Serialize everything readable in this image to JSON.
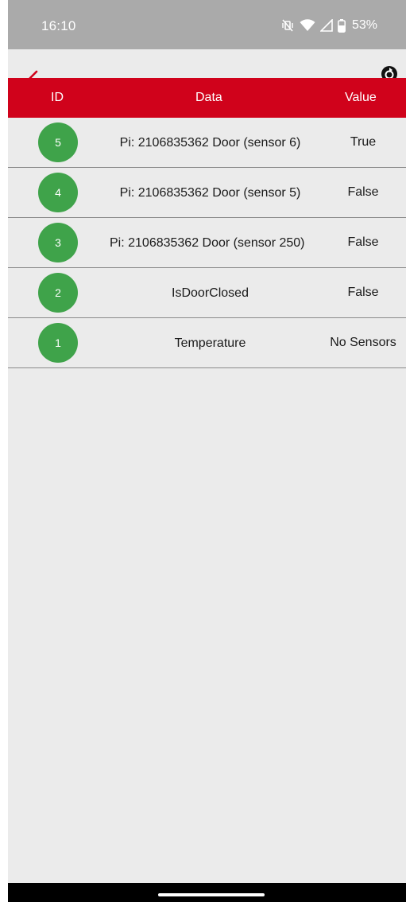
{
  "status_bar": {
    "time": "16:10",
    "battery": "53%",
    "icons": [
      "vibrate-off-icon",
      "wifi-icon",
      "signal-icon",
      "battery-icon"
    ]
  },
  "app_bar": {
    "icons": [
      "back-arrow-icon",
      "refresh-icon"
    ],
    "accent_color": "#d0021b"
  },
  "table": {
    "headers": {
      "id": "ID",
      "data": "Data",
      "value": "Value"
    },
    "badge_color": "#3fa34a",
    "rows": [
      {
        "id": "5",
        "data": "Pi: 2106835362 Door (sensor 6)",
        "value": "True"
      },
      {
        "id": "4",
        "data": "Pi: 2106835362 Door (sensor 5)",
        "value": "False"
      },
      {
        "id": "3",
        "data": "Pi: 2106835362 Door (sensor 250)",
        "value": "False"
      },
      {
        "id": "2",
        "data": "IsDoorClosed",
        "value": "False"
      },
      {
        "id": "1",
        "data": "Temperature",
        "value": "No Sensors"
      }
    ]
  }
}
